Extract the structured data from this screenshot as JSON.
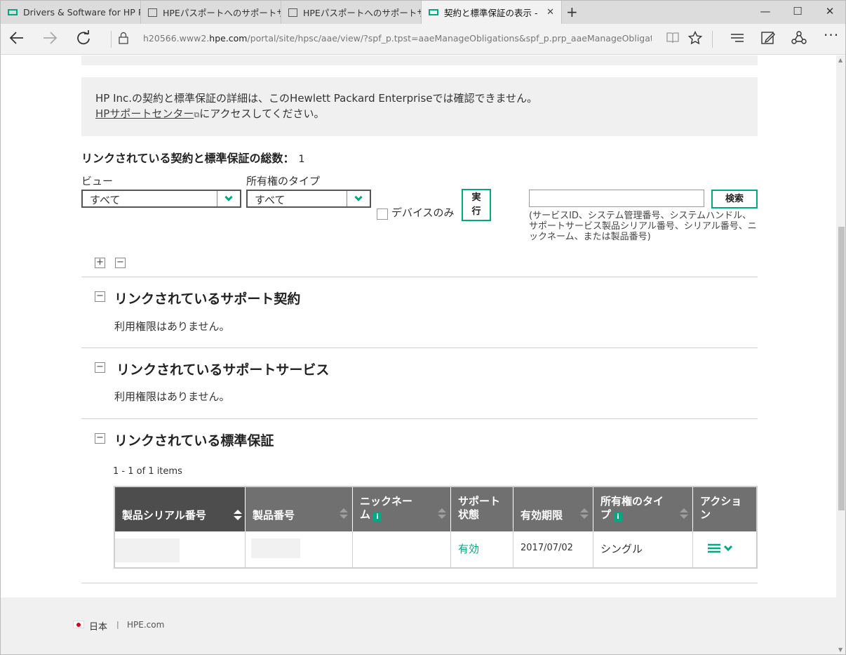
{
  "browser": {
    "tabs": [
      {
        "label": "Drivers & Software for HP P",
        "icon": "hpe-icon"
      },
      {
        "label": "HPEパスポートへのサポートサービ",
        "icon": "page-icon"
      },
      {
        "label": "HPEパスポートへのサポートサービ",
        "icon": "page-icon"
      },
      {
        "label": "契約と標準保証の表示 - ",
        "icon": "hpe-icon",
        "active": true
      }
    ],
    "url_prefix": "h20566.www2.",
    "url_domain": "hpe.com",
    "url_rest": "/portal/site/hpsc/aae/view/?spf_p.tpst=aaeManageObligations&spf_p.prp_aaeManageObligations=wsrp"
  },
  "notice": {
    "line1": "HP Inc.の契約と標準保証の詳細は、このHewlett Packard Enterpriseでは確認できません。",
    "link": "HPサポートセンター",
    "line2_rest": "にアクセスしてください。"
  },
  "summary": {
    "label": "リンクされている契約と標準保証の総数：",
    "count": "1"
  },
  "filters": {
    "view_label": "ビュー",
    "view_value": "すべて",
    "owner_label": "所有権のタイプ",
    "owner_value": "すべて",
    "device_only": "デバイスのみ",
    "run_line1": "実",
    "run_line2": "行",
    "search_button": "検索",
    "search_hint": "(サービスID、システム管理番号、システムハンドル、サポートサービス製品シリアル番号、シリアル番号、ニックネーム、または製品番号)"
  },
  "sections": [
    {
      "title": "リンクされているサポート契約",
      "body": "利用権限はありません。"
    },
    {
      "title": "リンクされているサポートサービス",
      "body": "利用権限はありません。"
    },
    {
      "title": "リンクされている標準保証"
    }
  ],
  "warranty": {
    "items_text": "1 - 1 of 1 items",
    "columns": [
      {
        "line1": "製品シリアル番号",
        "line2": ""
      },
      {
        "line1": "製品番号",
        "line2": ""
      },
      {
        "line1": "ニックネー",
        "line2": "ム"
      },
      {
        "line1": "サポート",
        "line2": "状態"
      },
      {
        "line1": "有効期限",
        "line2": ""
      },
      {
        "line1": "所有権のタイ",
        "line2": "プ"
      },
      {
        "line1": "アクショ",
        "line2": "ン"
      }
    ],
    "row": {
      "support_status": "有効",
      "expiry": "2017/07/02",
      "ownership": "シングル"
    }
  },
  "footer": {
    "country": "日本",
    "separator": "|",
    "link": "HPE.com"
  },
  "colors": {
    "accent": "#01a982",
    "header_dark": "#4d4d4d",
    "header": "#707070"
  }
}
